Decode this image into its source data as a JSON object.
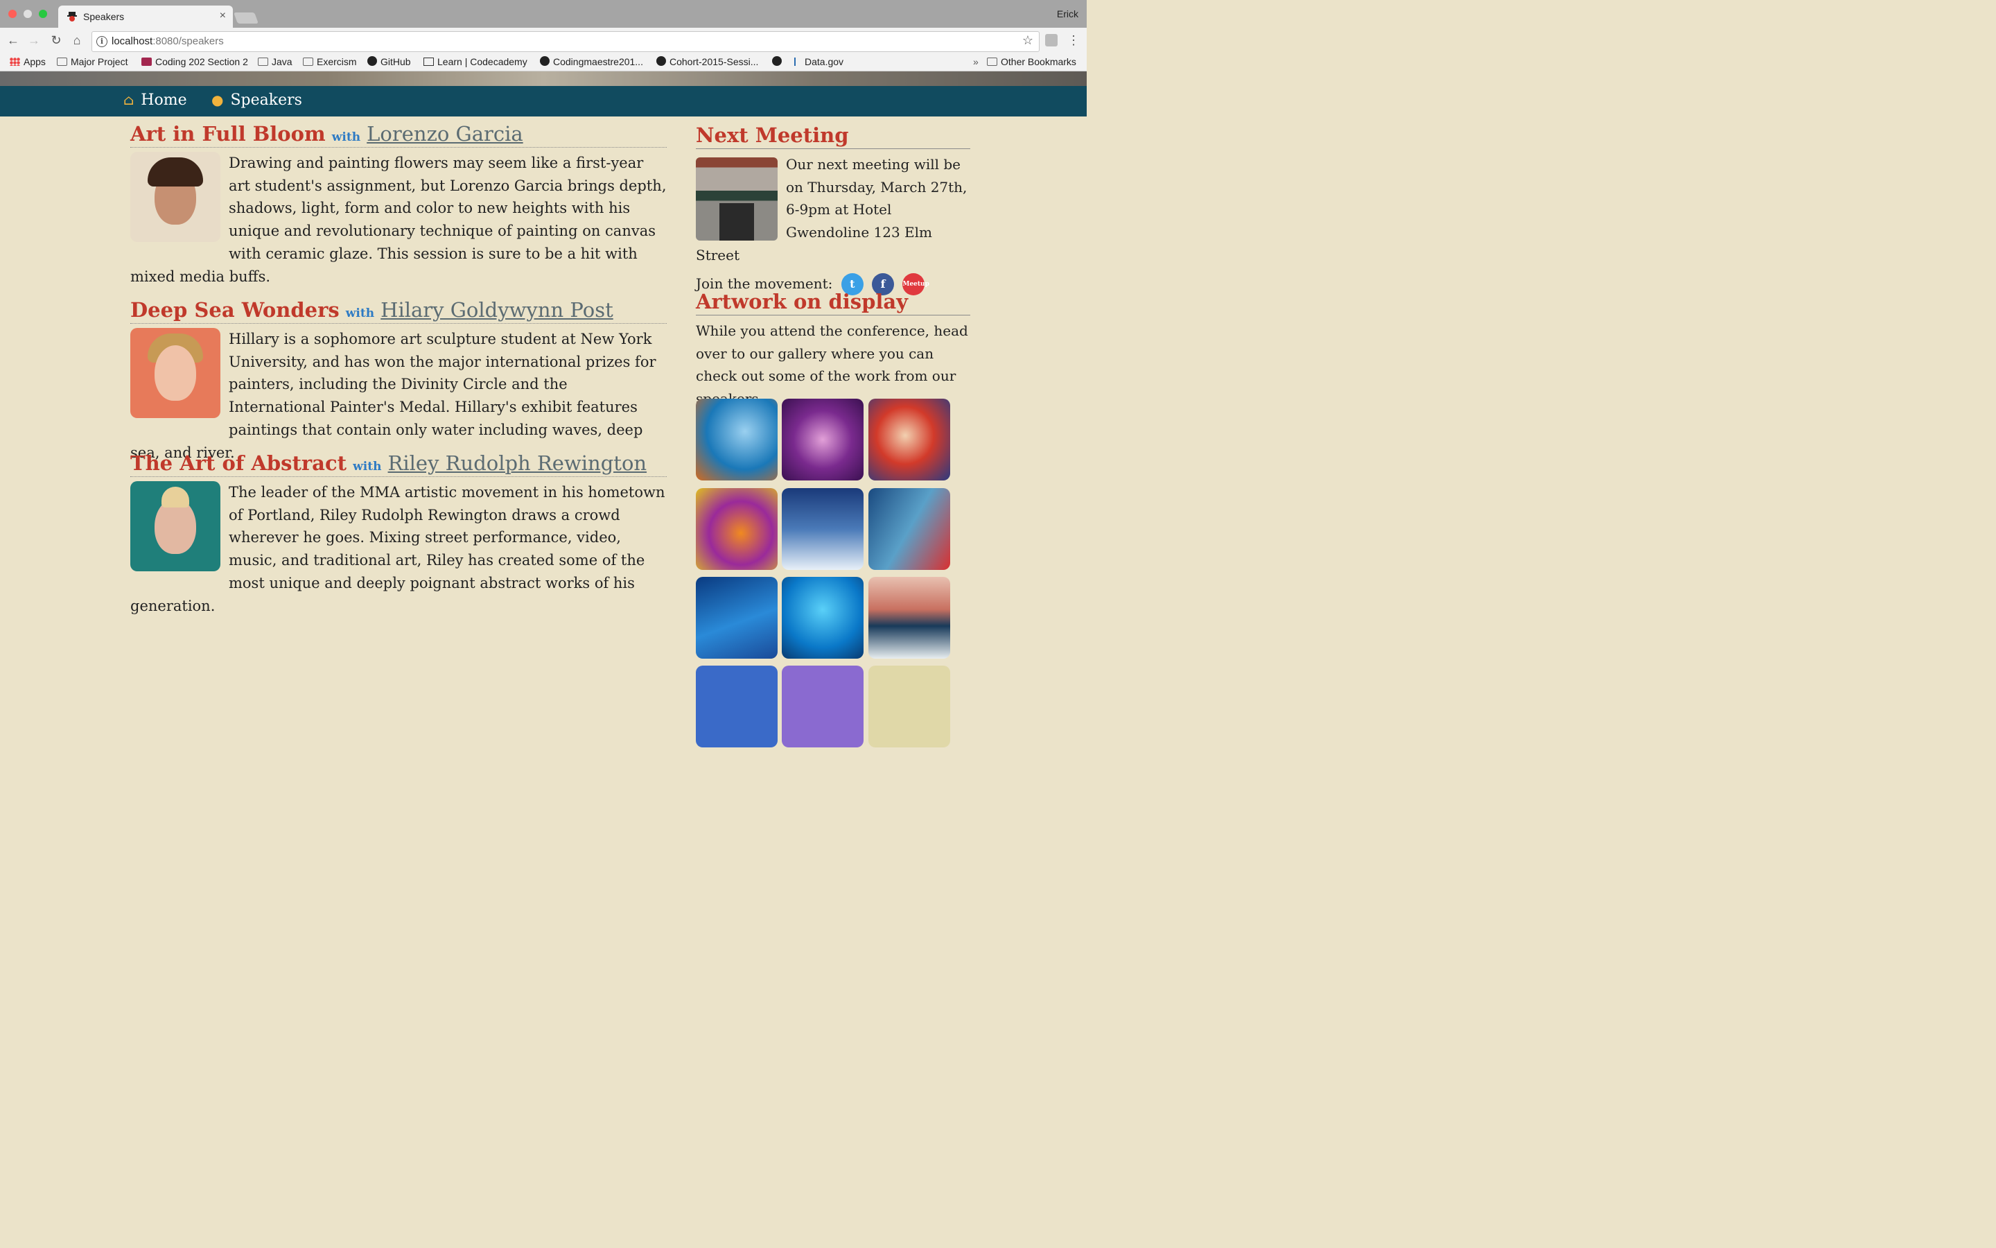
{
  "browser": {
    "tab_title": "Speakers",
    "tab_close": "×",
    "profile": "Erick",
    "url_host": "localhost",
    "url_path": ":8080/speakers",
    "bookmarks": [
      "Apps",
      "Major Project",
      "Coding 202 Section 2",
      "Java",
      "Exercism",
      "GitHub",
      "Learn | Codecademy",
      "Codingmaestre201...",
      "Cohort-2015-Sessi...",
      "Data.gov"
    ],
    "overflow": "»",
    "other_bookmarks": "Other Bookmarks"
  },
  "nav": {
    "home": "Home",
    "speakers": "Speakers"
  },
  "speakers": [
    {
      "title": "Art in Full Bloom",
      "with": "with",
      "name": "Lorenzo Garcia",
      "bio": "Drawing and painting flowers may seem like a first-year art student's assignment, but Lorenzo Garcia brings depth, shadows, light, form and color to new heights with his unique and revolutionary technique of painting on canvas with ceramic glaze. This session is sure to be a hit with mixed media buffs."
    },
    {
      "title": "Deep Sea Wonders",
      "with": "with",
      "name": "Hilary Goldywynn Post",
      "bio": "Hillary is a sophomore art sculpture student at New York University, and has won the major international prizes for painters, including the Divinity Circle and the International Painter's Medal. Hillary's exhibit features paintings that contain only water including waves, deep sea, and river."
    },
    {
      "title": "The Art of Abstract",
      "with": "with",
      "name": "Riley Rudolph Rewington",
      "bio": "The leader of the MMA artistic movement in his hometown of Portland, Riley Rudolph Rewington draws a crowd wherever he goes. Mixing street performance, video, music, and traditional art, Riley has created some of the most unique and deeply poignant abstract works of his generation."
    }
  ],
  "sidebar": {
    "next_meeting_heading": "Next Meeting",
    "next_meeting_text": "Our next meeting will be on Thursday, March 27th, 6-9pm at Hotel Gwendoline 123 Elm Street",
    "join_text": "Join the movement:",
    "meetup_label": "Meetup",
    "artwork_heading": "Artwork on display",
    "artwork_text": "While you attend the conference, head over to our gallery where you can check out some of the work from our speakers"
  },
  "colors": {
    "accent_red": "#c0392b",
    "nav_bg": "#114b5f",
    "page_bg": "#ebe3c9",
    "link_blue": "#2e7bc4"
  }
}
